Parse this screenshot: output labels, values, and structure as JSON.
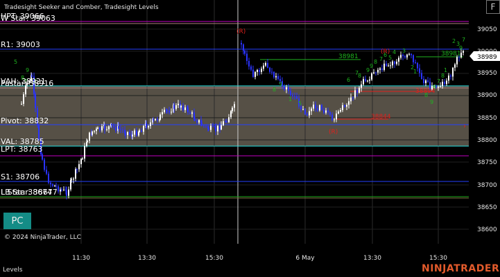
{
  "window": {
    "indicators_title": "Tradesight Seeker and Comber, Tradesight Levels",
    "copyright": "© 2024 NinjaTrader, LLC",
    "footer_label": "Levels",
    "brand": "NINJATRADER",
    "f_button": "F",
    "pc_button": "PC"
  },
  "colors": {
    "background": "#000000",
    "value_area": "#565046",
    "candle_up": "#ffffff",
    "candle_down": "#2a33ff",
    "signal_green": "#1fb41f",
    "signal_red": "#e0201c",
    "price_marker": "#ffffff"
  },
  "price_axis": {
    "ticks": [
      "39050",
      "39000",
      "38950",
      "38900",
      "38850",
      "38800",
      "38750",
      "38700",
      "38650",
      "38600"
    ],
    "last_price": "38989"
  },
  "time_axis": {
    "labels": [
      "11:30",
      "13:30",
      "15:30",
      "6 May",
      "13:30",
      "15:30"
    ]
  },
  "level_labels": {
    "hpt_overlap": "HPT: 39066",
    "wstar_overlap": "W Star: 39063",
    "r1": "R1: 39003",
    "vah_overlap": "VAH: 38921",
    "pastar_overlap": "Pastar: 38916",
    "pivot": "Pivot: 38832",
    "val": "VAL: 38785",
    "lpt": "LPT: 38763",
    "s1": "S1: 38706",
    "lbstar_overlap": "LB Star: 38677",
    "lstar_overlap": "L Star: 38674"
  },
  "chart_marks": {
    "day2_r_top_left": "(R)",
    "day2_r_top_right": "(R)",
    "day2_r_bottom": "(R)",
    "green_line_a": "38981",
    "green_line_b": "38981",
    "red_line_a": "38844",
    "red_line_b": "38894"
  },
  "seq_counts": {
    "day1": [
      "5",
      "9",
      "8",
      "7",
      "2"
    ],
    "day2": [
      "8",
      "9",
      "1",
      "5",
      "6",
      "7",
      "8",
      "9",
      "9",
      "8",
      "7",
      "6",
      "5",
      "4",
      "3",
      "2",
      "1",
      "8",
      "9",
      "6",
      "7",
      "8",
      "1",
      "2",
      "3",
      "9",
      "7"
    ]
  }
}
